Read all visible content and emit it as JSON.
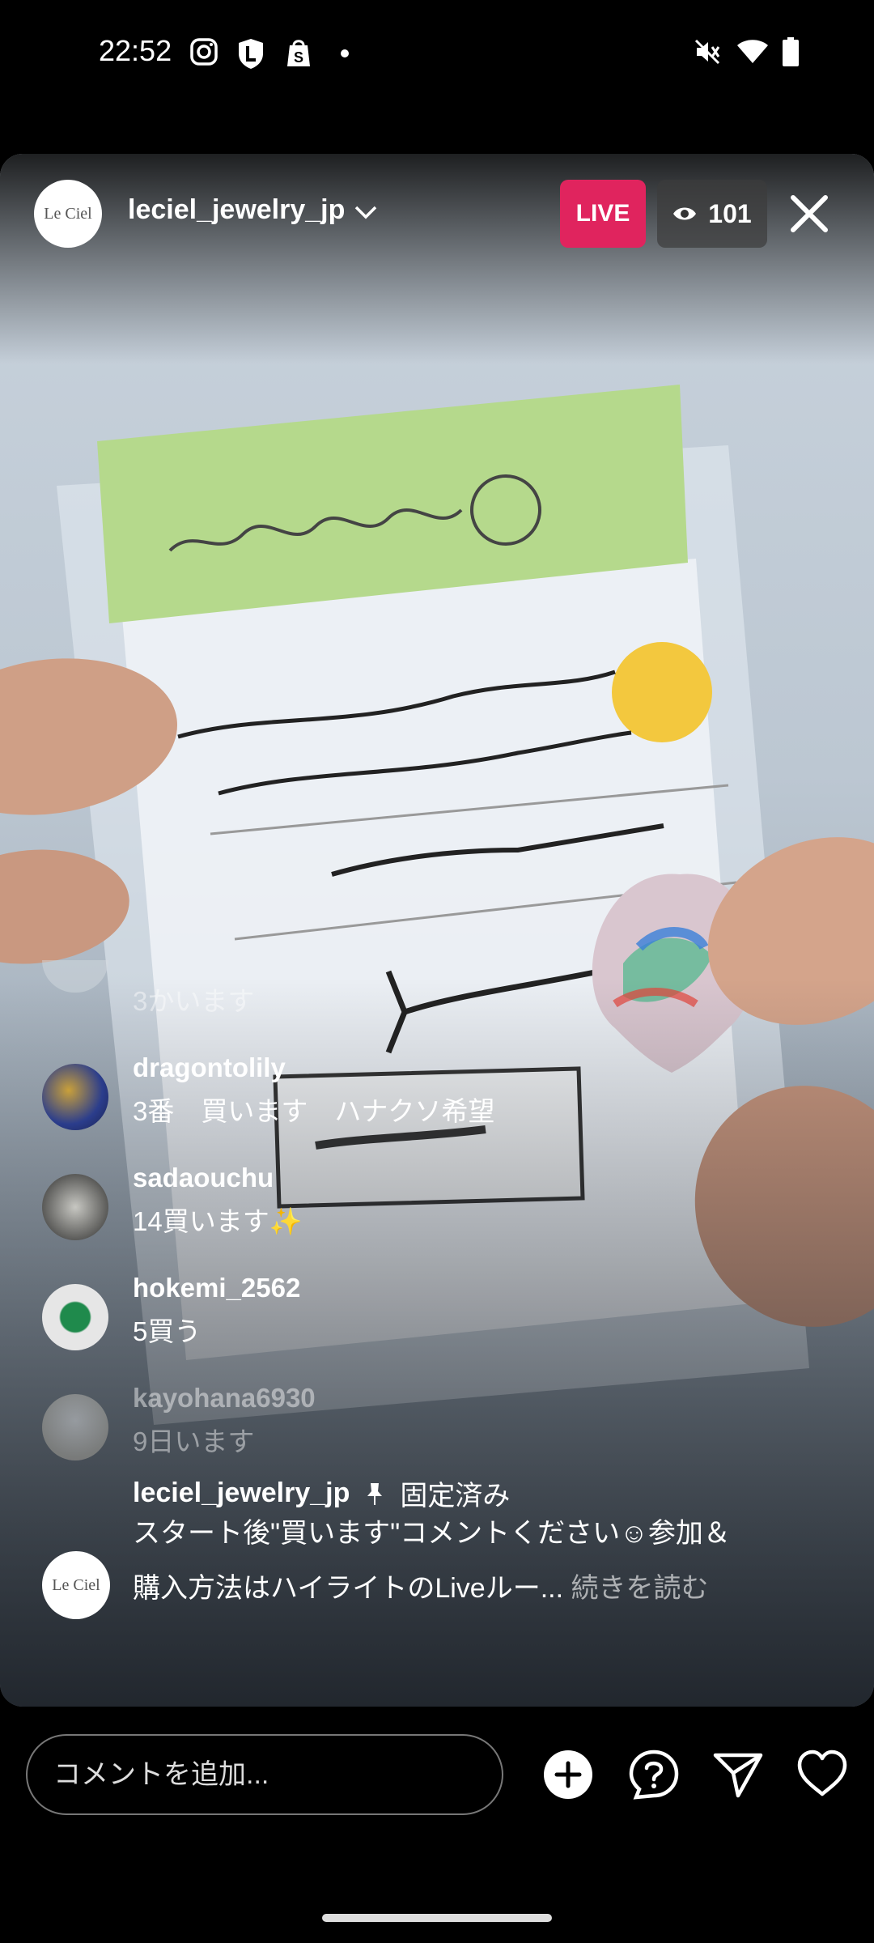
{
  "status": {
    "time": "22:52"
  },
  "header": {
    "logo_text": "Le Ciel",
    "host": "leciel_jewelry_jp",
    "live_label": "LIVE",
    "viewer_count": "101"
  },
  "comments": [
    {
      "user": "",
      "text": "3かいます"
    },
    {
      "user": "dragontolily",
      "text": "3番　買います　ハナクソ希望"
    },
    {
      "user": "sadaouchu",
      "text": "14買います✨"
    },
    {
      "user": "hokemi_2562",
      "text": "5買う"
    },
    {
      "user": "kayohana6930",
      "text": "9日います"
    }
  ],
  "pinned": {
    "user": "leciel_jewelry_jp",
    "label": "固定済み",
    "text": "スタート後\"買います\"コメントください☺参加＆購入方法はハイライトのLiveルー...",
    "more": "続きを読む"
  },
  "bottom": {
    "placeholder": "コメントを追加..."
  }
}
